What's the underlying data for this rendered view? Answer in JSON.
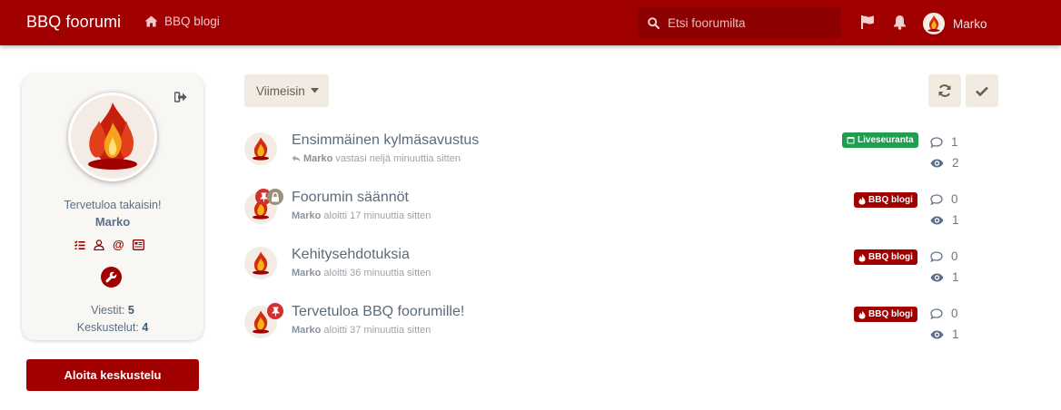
{
  "header": {
    "brand": "BBQ foorumi",
    "blog_link": "BBQ blogi",
    "search_placeholder": "Etsi foorumilta",
    "username": "Marko"
  },
  "sidebar": {
    "welcome": "Tervetuloa takaisin!",
    "username": "Marko",
    "posts_label": "Viestit",
    "posts_value": "5",
    "topics_label": "Keskustelut",
    "topics_value": "4",
    "new_topic_button": "Aloita keskustelu"
  },
  "toolbar": {
    "sort_label": "Viimeisin"
  },
  "topics": [
    {
      "title": "Ensimmäinen kylmäsavustus",
      "author": "Marko",
      "action": "vastasi neljä minuuttia sitten",
      "badge": "Liveseuranta",
      "replies": "1",
      "views": "2"
    },
    {
      "title": "Foorumin säännöt",
      "author": "Marko",
      "action": "aloitti 17 minuuttia sitten",
      "badge": "BBQ blogi",
      "replies": "0",
      "views": "1"
    },
    {
      "title": "Kehitysehdotuksia",
      "author": "Marko",
      "action": "aloitti 36 minuuttia sitten",
      "badge": "BBQ blogi",
      "replies": "0",
      "views": "1"
    },
    {
      "title": "Tervetuloa BBQ foorumille!",
      "author": "Marko",
      "action": "aloitti 37 minuuttia sitten",
      "badge": "BBQ blogi",
      "replies": "0",
      "views": "1"
    }
  ],
  "colors": {
    "brand": "#a10000",
    "live_badge": "#1e9e4e"
  }
}
